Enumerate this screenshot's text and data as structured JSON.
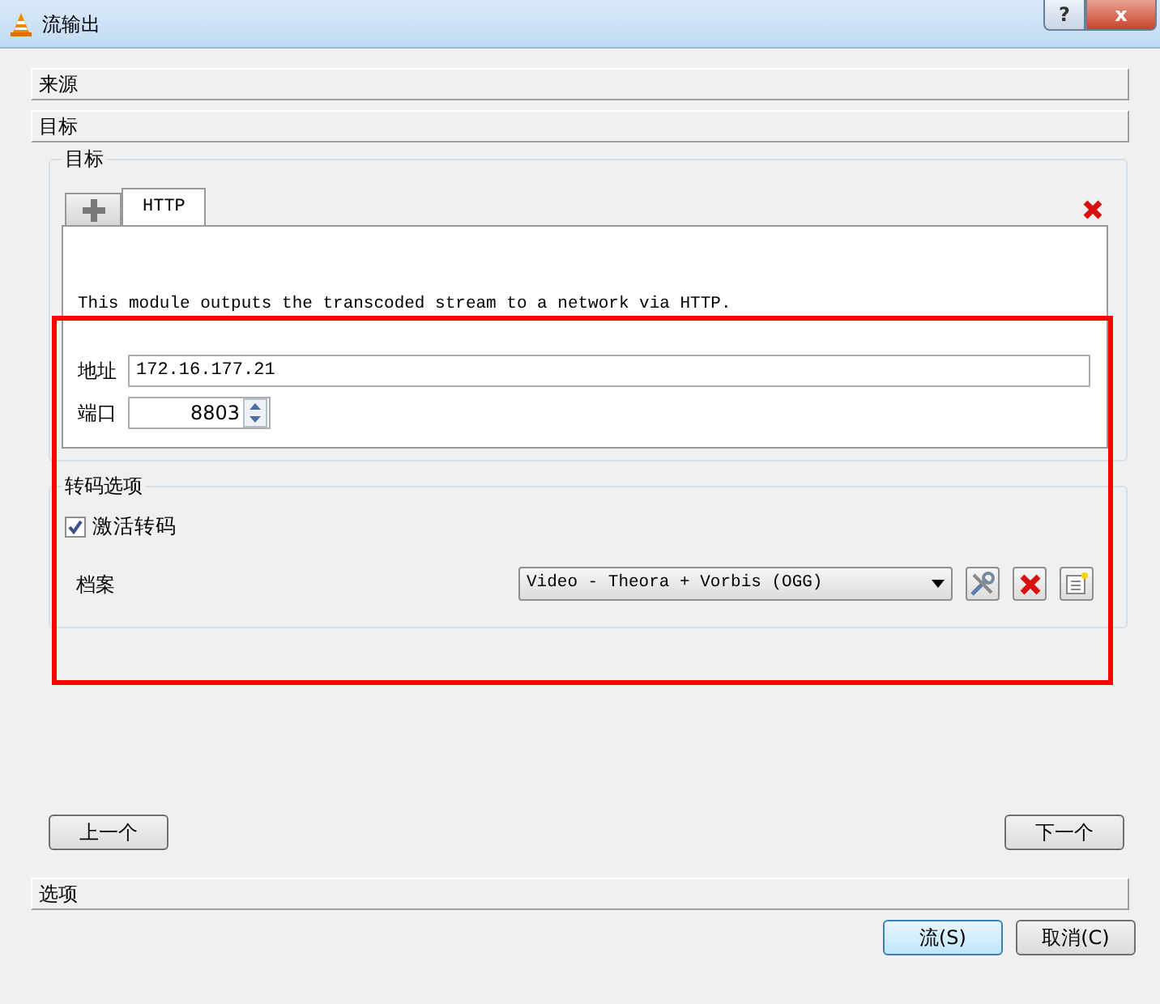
{
  "window": {
    "title": "流输出",
    "buttons": [
      {
        "kind": "help",
        "label": "?"
      },
      {
        "kind": "close",
        "label": "x"
      }
    ]
  },
  "sections": [
    {
      "label": "来源"
    },
    {
      "label": "目标"
    }
  ],
  "destination": {
    "title": "目标",
    "tabs": [
      {
        "label": "HTTP",
        "selected": true
      }
    ],
    "description": "This module outputs the transcoded stream to a network via HTTP.",
    "fields": [
      {
        "kind": "text",
        "label": "地址",
        "value": "172.16.177.21"
      },
      {
        "kind": "spin",
        "label": "端口",
        "value": "8803"
      }
    ]
  },
  "transcoding": {
    "title": "转码选项",
    "activate": {
      "label": "激活转码",
      "checked": true
    },
    "profile": {
      "label": "档案",
      "value": "Video - Theora + Vorbis (OGG)"
    }
  },
  "nav_buttons": [
    {
      "label": "上一个"
    },
    {
      "label": "下一个"
    }
  ],
  "options_section": {
    "label": "选项"
  },
  "footer_buttons": [
    {
      "label": "流(S)",
      "default": true
    },
    {
      "label": "取消(C)",
      "default": false
    }
  ],
  "annotations": [
    {
      "kind": "rectangle"
    }
  ]
}
